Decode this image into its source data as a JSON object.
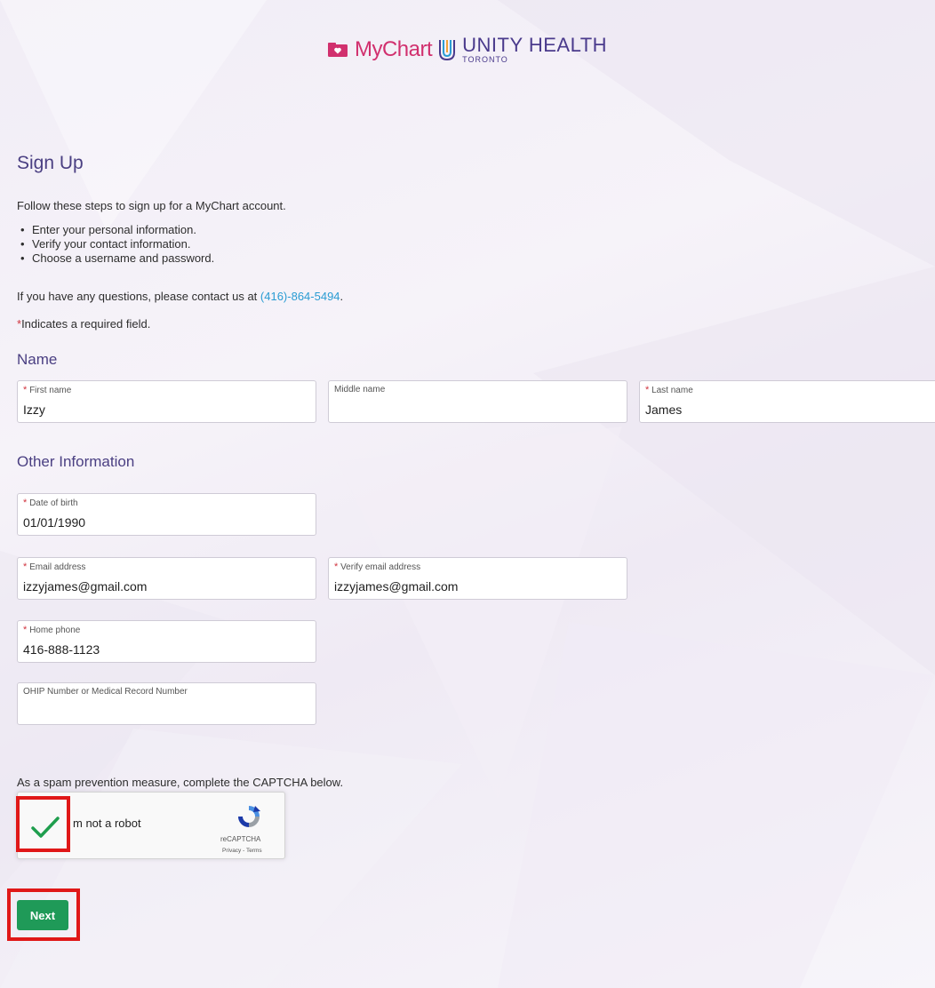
{
  "header": {
    "mychart_logo": "MyChart",
    "unity_name": "UNITY HEALTH",
    "unity_sub": "TORONTO"
  },
  "page": {
    "title": "Sign Up",
    "intro": "Follow these steps to sign up for a MyChart account.",
    "steps": [
      "Enter your personal information.",
      "Verify your contact information.",
      "Choose a username and password."
    ],
    "contact_prefix": "If you have any questions, please contact us at ",
    "contact_phone": "(416)-864-5494",
    "contact_suffix": ".",
    "required_marker": "*",
    "required_note": "Indicates a required field."
  },
  "name_section": {
    "heading": "Name",
    "fields": [
      {
        "label": "First name",
        "required": true,
        "value": "Izzy"
      },
      {
        "label": "Middle name",
        "required": false,
        "value": ""
      },
      {
        "label": "Last name",
        "required": true,
        "value": "James"
      }
    ]
  },
  "other_section": {
    "heading": "Other Information",
    "fields": [
      {
        "label": "Date of birth",
        "required": true,
        "value": "01/01/1990"
      },
      {
        "label": "Email address",
        "required": true,
        "value": "izzyjames@gmail.com"
      },
      {
        "label": "Verify email address",
        "required": true,
        "value": "izzyjames@gmail.com"
      },
      {
        "label": "Home phone",
        "required": true,
        "value": "416-888-1123"
      },
      {
        "label": "OHIP Number or Medical Record Number",
        "required": false,
        "value": ""
      }
    ]
  },
  "captcha": {
    "instruction": "As a spam prevention measure, complete the CAPTCHA below.",
    "label": "m not a robot",
    "checked": true,
    "brand": "reCAPTCHA",
    "links": "Privacy - Terms"
  },
  "actions": {
    "next_label": "Next",
    "primary_color": "#1f9a58"
  },
  "colors": {
    "accent": "#4a3f82",
    "required": "#d0343f",
    "link": "#2a9cd3",
    "highlight": "#e01818"
  }
}
